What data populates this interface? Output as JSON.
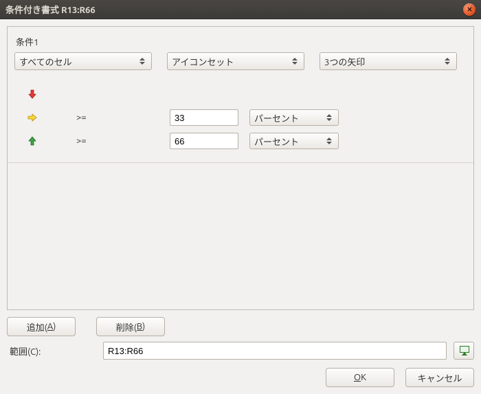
{
  "window": {
    "title": "条件付き書式 R13:R66"
  },
  "condition": {
    "label": "条件1",
    "apply_to": "すべてのセル",
    "style": "アイコンセット",
    "iconset": "3つの矢印",
    "rules": [
      {
        "op": "",
        "value": "",
        "unit": ""
      },
      {
        "op": ">=",
        "value": "33",
        "unit": "パーセント"
      },
      {
        "op": ">=",
        "value": "66",
        "unit": "パーセント"
      }
    ]
  },
  "buttons": {
    "add_pre": "追加(",
    "add_ul": "A",
    "add_post": ")",
    "del_pre": "削除(",
    "del_ul": "B",
    "del_post": ")",
    "ok_ul": "O",
    "ok_post": "K",
    "cancel": "キャンセル"
  },
  "range": {
    "label": "範囲(C):",
    "value": "R13:R66"
  }
}
